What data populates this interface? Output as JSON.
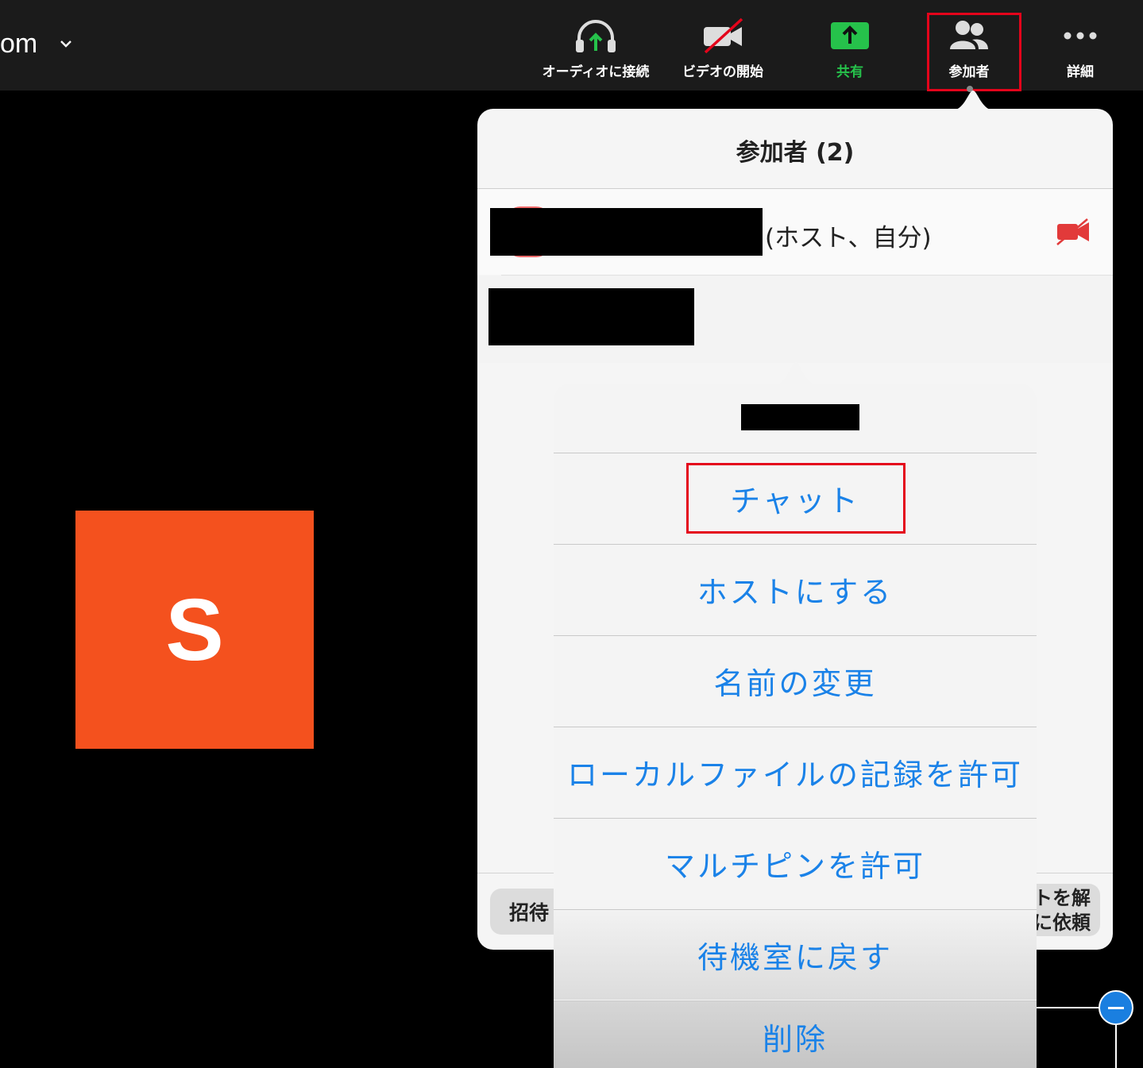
{
  "toolbar": {
    "app_title": "om",
    "buttons": [
      {
        "label": "オーディオに接続",
        "icon": "headphones-upload-icon"
      },
      {
        "label": "ビデオの開始",
        "icon": "video-off-icon"
      },
      {
        "label": "共有",
        "icon": "share-upload-icon",
        "color": "#26c24b"
      },
      {
        "label": "参加者",
        "icon": "participants-icon",
        "highlighted": true
      },
      {
        "label": "詳細",
        "icon": "more-dots-icon"
      }
    ]
  },
  "avatar": {
    "initial": "S",
    "color": "#f4511e"
  },
  "participants_panel": {
    "title": "参加者 (2)",
    "self_suffix": "(ホスト、自分)",
    "invite_label": "招待",
    "right_button_label": [
      "トを解",
      "に依頼"
    ]
  },
  "action_sheet": {
    "items": [
      {
        "label": "チャット",
        "highlighted": true
      },
      {
        "label": "ホストにする"
      },
      {
        "label": "名前の変更"
      },
      {
        "label": "ローカルファイルの記録を許可"
      },
      {
        "label": "マルチピンを許可"
      },
      {
        "label": "待機室に戻す"
      },
      {
        "label": "削除"
      }
    ]
  },
  "colors": {
    "accent_blue": "#1a82e8",
    "highlight_red": "#e4041b",
    "share_green": "#26c24b"
  }
}
